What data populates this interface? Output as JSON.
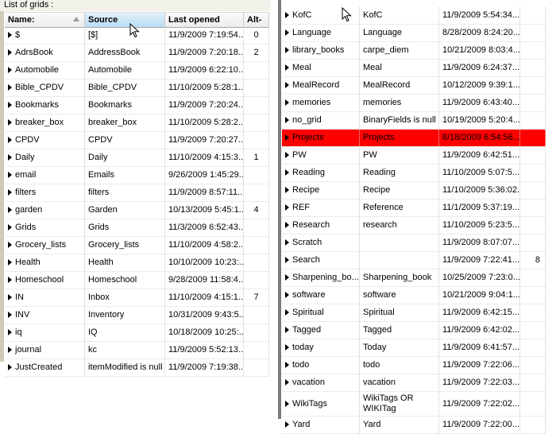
{
  "left": {
    "caption": "List of grids :",
    "headers": {
      "name": "Name:",
      "source": "Source",
      "last_opened": "Last opened",
      "alt": "Alt-"
    },
    "rows": [
      {
        "name": "$",
        "source": "[$]",
        "opened": "11/9/2009 7:19:54...",
        "alt": "0"
      },
      {
        "name": "AdrsBook",
        "source": "AddressBook",
        "opened": "11/9/2009 7:20:18...",
        "alt": "2"
      },
      {
        "name": "Automobile",
        "source": "Automobile",
        "opened": "11/9/2009 6:22:10...",
        "alt": ""
      },
      {
        "name": "Bible_CPDV",
        "source": "Bible_CPDV",
        "opened": "11/10/2009 5:28:1...",
        "alt": ""
      },
      {
        "name": "Bookmarks",
        "source": "Bookmarks",
        "opened": "11/9/2009 7:20:24...",
        "alt": ""
      },
      {
        "name": "breaker_box",
        "source": "breaker_box",
        "opened": "11/10/2009 5:28:2...",
        "alt": ""
      },
      {
        "name": "CPDV",
        "source": "CPDV",
        "opened": "11/9/2009 7:20:27...",
        "alt": ""
      },
      {
        "name": "Daily",
        "source": "Daily",
        "opened": "11/10/2009 4:15:3...",
        "alt": "1"
      },
      {
        "name": "email",
        "source": "Emails",
        "opened": "9/26/2009 1:45:29...",
        "alt": ""
      },
      {
        "name": "filters",
        "source": "filters",
        "opened": "11/9/2009 8:57:11...",
        "alt": ""
      },
      {
        "name": "garden",
        "source": "Garden",
        "opened": "10/13/2009 5:45:1...",
        "alt": "4"
      },
      {
        "name": "Grids",
        "source": "Grids",
        "opened": "11/3/2009 6:52:43...",
        "alt": ""
      },
      {
        "name": "Grocery_lists",
        "source": "Grocery_lists",
        "opened": "11/10/2009 4:58:2...",
        "alt": ""
      },
      {
        "name": "Health",
        "source": "Health",
        "opened": "10/10/2009 10:23:...",
        "alt": ""
      },
      {
        "name": "Homeschool",
        "source": "Homeschool",
        "opened": "9/28/2009 11:58:4...",
        "alt": ""
      },
      {
        "name": "IN",
        "source": "Inbox",
        "opened": "11/10/2009 4:15:1...",
        "alt": "7"
      },
      {
        "name": "INV",
        "source": "Inventory",
        "opened": "10/31/2009 9:43:5...",
        "alt": ""
      },
      {
        "name": "iq",
        "source": "IQ",
        "opened": "10/18/2009 10:25:...",
        "alt": ""
      },
      {
        "name": "journal",
        "source": "kc",
        "opened": "11/9/2009 5:52:13...",
        "alt": ""
      },
      {
        "name": "JustCreated",
        "source": "itemModified is null",
        "opened": "11/9/2009 7:19:38...",
        "alt": ""
      }
    ]
  },
  "right": {
    "rows": [
      {
        "name": "KofC",
        "source": "KofC",
        "opened": "11/9/2009 5:54:34...",
        "alt": ""
      },
      {
        "name": "Language",
        "source": "Language",
        "opened": "8/28/2009 8:24:20...",
        "alt": ""
      },
      {
        "name": "library_books",
        "source": "carpe_diem",
        "opened": "10/21/2009 8:03:4...",
        "alt": ""
      },
      {
        "name": "Meal",
        "source": "Meal",
        "opened": "11/9/2009 6:24:37...",
        "alt": ""
      },
      {
        "name": "MealRecord",
        "source": "MealRecord",
        "opened": "10/12/2009 9:39:1...",
        "alt": ""
      },
      {
        "name": "memories",
        "source": "memories",
        "opened": "11/9/2009 6:43:40...",
        "alt": ""
      },
      {
        "name": "no_grid",
        "source": "BinaryFields is null",
        "opened": "10/19/2009 5:20:4...",
        "alt": ""
      },
      {
        "name": "Projects",
        "source": "Projects",
        "opened": "8/18/2009 6:54:56...",
        "alt": "",
        "selected": true
      },
      {
        "name": "PW",
        "source": "PW",
        "opened": "11/9/2009 6:42:51...",
        "alt": ""
      },
      {
        "name": "Reading",
        "source": "Reading",
        "opened": "11/10/2009 5:07:5...",
        "alt": ""
      },
      {
        "name": "Recipe",
        "source": "Recipe",
        "opened": "11/10/2009 5:36:02...",
        "alt": ""
      },
      {
        "name": "REF",
        "source": "Reference",
        "opened": "11/1/2009 5:37:19...",
        "alt": ""
      },
      {
        "name": "Research",
        "source": "research",
        "opened": "11/10/2009 5:23:5...",
        "alt": ""
      },
      {
        "name": "Scratch",
        "source": "",
        "opened": "11/9/2009 8:07:07...",
        "alt": ""
      },
      {
        "name": "Search",
        "source": "",
        "opened": "11/9/2009 7:22:41...",
        "alt": "8"
      },
      {
        "name": "Sharpening_bo...",
        "source": "Sharpening_book",
        "opened": "10/25/2009 7:23:0...",
        "alt": ""
      },
      {
        "name": "software",
        "source": "software",
        "opened": "10/21/2009 9:04:1...",
        "alt": ""
      },
      {
        "name": "Spiritual",
        "source": "Spiritual",
        "opened": "11/9/2009 6:42:15...",
        "alt": ""
      },
      {
        "name": "Tagged",
        "source": "Tagged",
        "opened": "11/9/2009 6:42:02...",
        "alt": ""
      },
      {
        "name": "today",
        "source": "Today",
        "opened": "11/9/2009 6:41:57...",
        "alt": ""
      },
      {
        "name": "todo",
        "source": "todo",
        "opened": "11/9/2009 7:22:06...",
        "alt": ""
      },
      {
        "name": "vacation",
        "source": "vacation",
        "opened": "11/9/2009 7:22:03...",
        "alt": ""
      },
      {
        "name": "WikiTags",
        "source": "WikiTags OR WIKITag",
        "opened": "11/9/2009 7:22:02...",
        "alt": "",
        "tall": true
      },
      {
        "name": "Yard",
        "source": "Yard",
        "opened": "11/9/2009 7:22:00...",
        "alt": ""
      }
    ]
  },
  "colors": {
    "selected_row": "#ff0000",
    "sorted_header": "#b9dcf4"
  },
  "icons": {
    "row_expander": "triangle-right-icon",
    "sort_indicator": "sort-ascending-icon",
    "cursor": "mouse-pointer-icon"
  }
}
